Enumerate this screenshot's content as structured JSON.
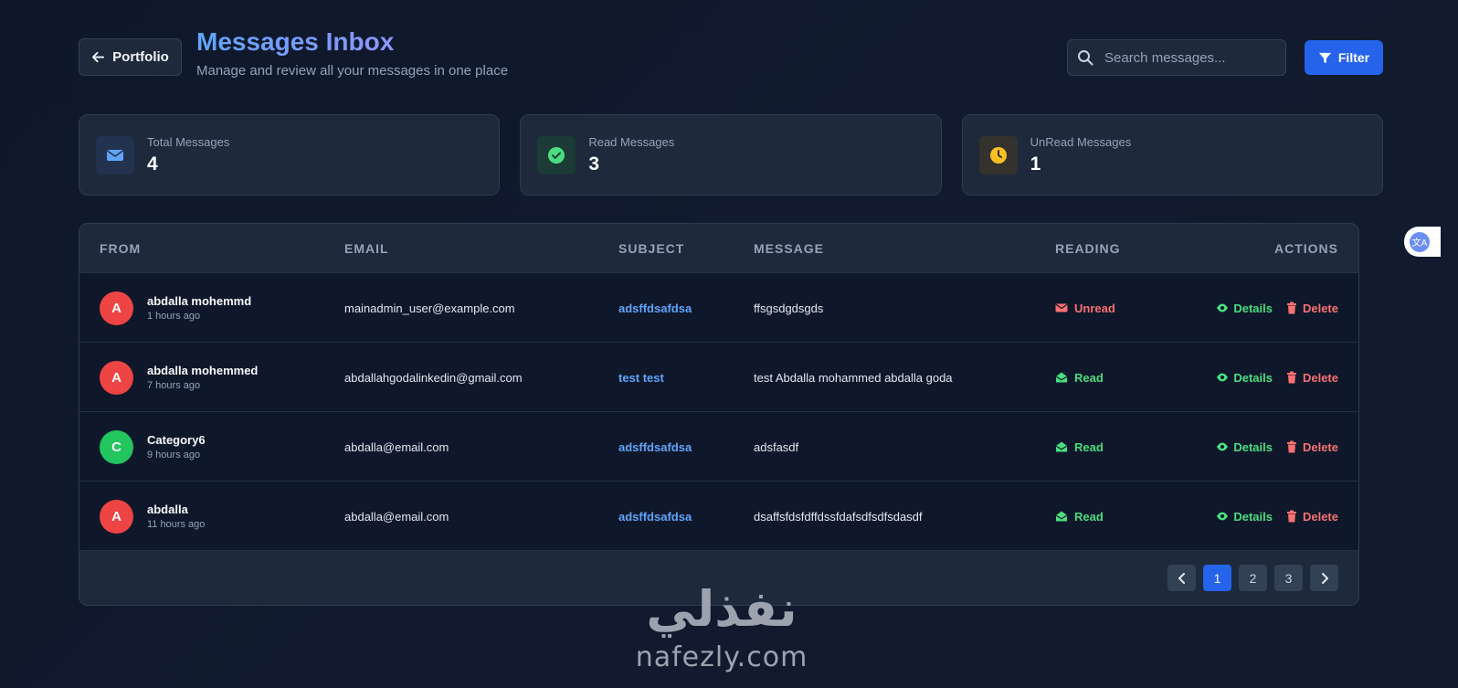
{
  "header": {
    "back_label": "Portfolio",
    "title": "Messages Inbox",
    "subtitle": "Manage and review all your messages in one place",
    "search_placeholder": "Search messages...",
    "filter_label": "Filter"
  },
  "stats": [
    {
      "label": "Total Messages",
      "value": "4",
      "icon": "envelope-icon",
      "color": "#60a5fa"
    },
    {
      "label": "Read Messages",
      "value": "3",
      "icon": "check-circle-icon",
      "color": "#4ade80"
    },
    {
      "label": "UnRead Messages",
      "value": "1",
      "icon": "clock-icon",
      "color": "#fbbf24"
    }
  ],
  "table": {
    "columns": [
      "FROM",
      "EMAIL",
      "SUBJECT",
      "MESSAGE",
      "READING",
      "ACTIONS"
    ],
    "rows": [
      {
        "initial": "A",
        "avatar_color": "#ef4444",
        "name": "abdalla mohemmd",
        "time": "1 hours ago",
        "email": "mainadmin_user@example.com",
        "subject": "adsffdsafdsa",
        "message": "ffsgsdgdsgds",
        "status": "Unread",
        "details": "Details",
        "delete": "Delete"
      },
      {
        "initial": "A",
        "avatar_color": "#ef4444",
        "name": "abdalla mohemmed",
        "time": "7 hours ago",
        "email": "abdallahgodalinkedin@gmail.com",
        "subject": "test test",
        "message": "test Abdalla mohammed abdalla goda",
        "status": "Read",
        "details": "Details",
        "delete": "Delete"
      },
      {
        "initial": "C",
        "avatar_color": "#22c55e",
        "name": "Category6",
        "time": "9 hours ago",
        "email": "abdalla@email.com",
        "subject": "adsffdsafdsa",
        "message": "adsfasdf",
        "status": "Read",
        "details": "Details",
        "delete": "Delete"
      },
      {
        "initial": "A",
        "avatar_color": "#ef4444",
        "name": "abdalla",
        "time": "11 hours ago",
        "email": "abdalla@email.com",
        "subject": "adsffdsafdsa",
        "message": "dsaffsfdsfdffdssfdafsdfsdfsdasdf",
        "status": "Read",
        "details": "Details",
        "delete": "Delete"
      }
    ]
  },
  "pagination": {
    "pages": [
      "1",
      "2",
      "3"
    ],
    "current": "1"
  },
  "colors": {
    "accent": "#2563eb",
    "read": "#4ade80",
    "unread": "#f87171",
    "subject": "#60a5fa"
  },
  "watermark": {
    "arabic": "نفذلي",
    "latin": "nafezly.com"
  },
  "translate_tab": {
    "label": "文A"
  }
}
